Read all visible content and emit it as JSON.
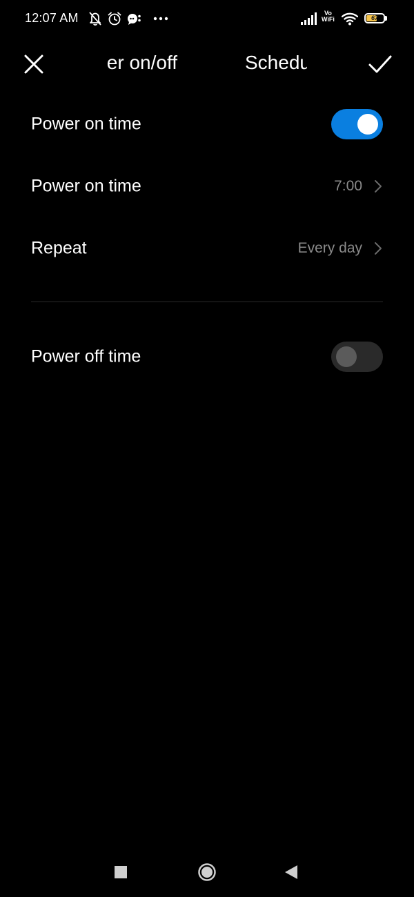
{
  "status_bar": {
    "time": "12:07 AM",
    "icons": [
      "bell-muted-icon",
      "alarm-icon",
      "chat-icon",
      "more-dots-icon",
      "signal-icon",
      "vowifi-icon",
      "wifi-icon",
      "battery-icon"
    ],
    "vowifi_top": "Vo",
    "vowifi_bottom": "WiFi",
    "battery_level": "67",
    "battery_color": "#f5c34a"
  },
  "title_bar": {
    "tabs": [
      {
        "label": "Power on/off"
      },
      {
        "label": "Schedule"
      }
    ],
    "close_icon": "close-icon",
    "confirm_icon": "checkmark-icon"
  },
  "power_on": {
    "toggle_label": "Power on time",
    "toggle_state": "on",
    "time_label": "Power on time",
    "time_value": "7:00",
    "repeat_label": "Repeat",
    "repeat_value": "Every day"
  },
  "power_off": {
    "toggle_label": "Power off time",
    "toggle_state": "off"
  },
  "colors": {
    "accent": "#0a7fe0",
    "background": "#000000",
    "secondary_text": "#8a8a8a"
  },
  "nav_bar": {
    "icons": [
      "recent-apps-icon",
      "home-icon",
      "back-icon"
    ]
  }
}
